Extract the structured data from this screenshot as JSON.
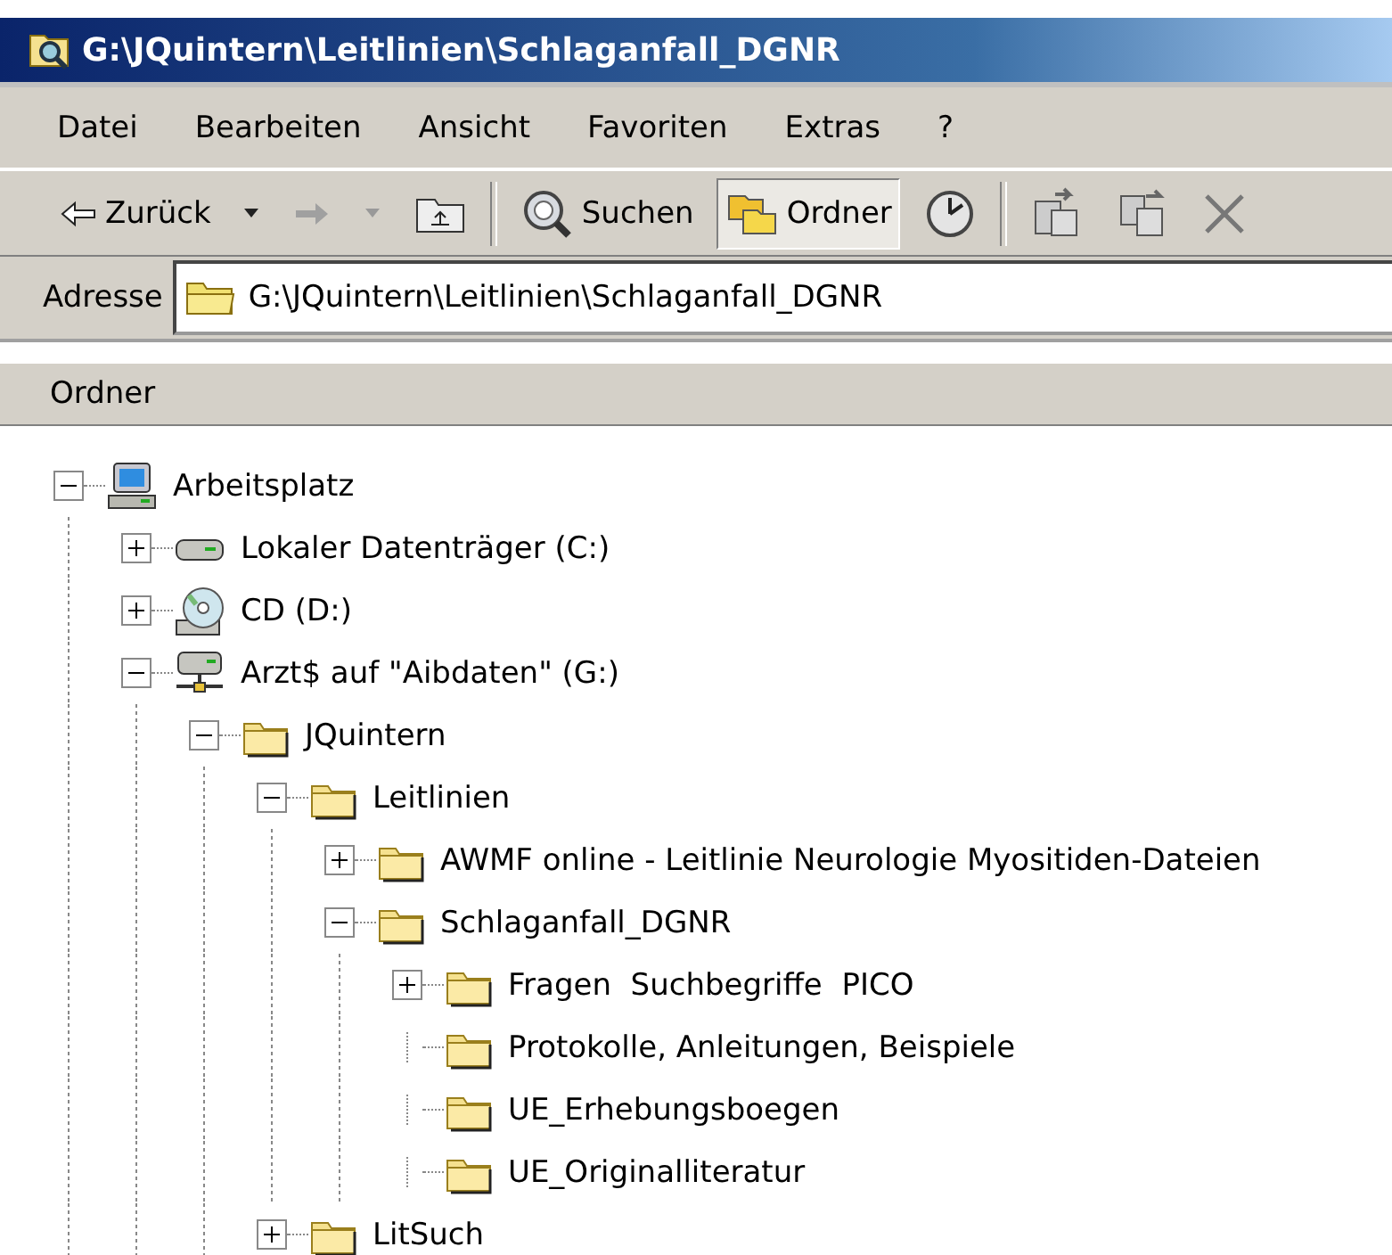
{
  "window": {
    "title": "G:\\JQuintern\\Leitlinien\\Schlaganfall_DGNR"
  },
  "menu": [
    "Datei",
    "Bearbeiten",
    "Ansicht",
    "Favoriten",
    "Extras",
    "?"
  ],
  "toolbar": [
    {
      "kind": "back",
      "label": "Zurück",
      "disabled": false
    },
    {
      "kind": "forward",
      "disabled": true
    },
    {
      "kind": "up"
    },
    {
      "kind": "sep"
    },
    {
      "kind": "search",
      "label": "Suchen",
      "selected": false
    },
    {
      "kind": "folders",
      "label": "Ordner",
      "selected": true
    },
    {
      "kind": "history"
    },
    {
      "kind": "sep"
    },
    {
      "kind": "moveto"
    },
    {
      "kind": "copyto"
    },
    {
      "kind": "delete"
    }
  ],
  "address": {
    "label": "Adresse",
    "value": "G:\\JQuintern\\Leitlinien\\Schlaganfall_DGNR"
  },
  "panel": {
    "title": "Ordner"
  },
  "tree": [
    {
      "label": "Arbeitsplatz",
      "kind": "computer",
      "expandable": true,
      "expanded": true,
      "children": [
        {
          "label": "Lokaler Datenträger (C:)",
          "kind": "disk",
          "expandable": true,
          "expanded": false
        },
        {
          "label": "CD (D:)",
          "kind": "cd",
          "expandable": true,
          "expanded": false
        },
        {
          "label": "Arzt$ auf \"Aibdaten\" (G:)",
          "kind": "network",
          "expandable": true,
          "expanded": true,
          "children": [
            {
              "label": "JQuintern",
              "kind": "folder",
              "expandable": true,
              "expanded": true,
              "children": [
                {
                  "label": "Leitlinien",
                  "kind": "folder",
                  "expandable": true,
                  "expanded": true,
                  "children": [
                    {
                      "label": "AWMF online - Leitlinie Neurologie Myositiden-Dateien",
                      "kind": "folder",
                      "expandable": true,
                      "expanded": false
                    },
                    {
                      "label": "Schlaganfall_DGNR",
                      "kind": "folder",
                      "expandable": true,
                      "expanded": true,
                      "children": [
                        {
                          "label": "Fragen  Suchbegriffe  PICO",
                          "kind": "folder",
                          "expandable": true,
                          "expanded": false
                        },
                        {
                          "label": "Protokolle, Anleitungen, Beispiele",
                          "kind": "folder",
                          "expandable": false
                        },
                        {
                          "label": "UE_Erhebungsboegen",
                          "kind": "folder",
                          "expandable": false
                        },
                        {
                          "label": "UE_Originalliteratur",
                          "kind": "folder",
                          "expandable": false
                        }
                      ]
                    }
                  ]
                },
                {
                  "label": "LitSuch",
                  "kind": "folder",
                  "expandable": true,
                  "expanded": false
                }
              ]
            }
          ]
        }
      ]
    }
  ]
}
